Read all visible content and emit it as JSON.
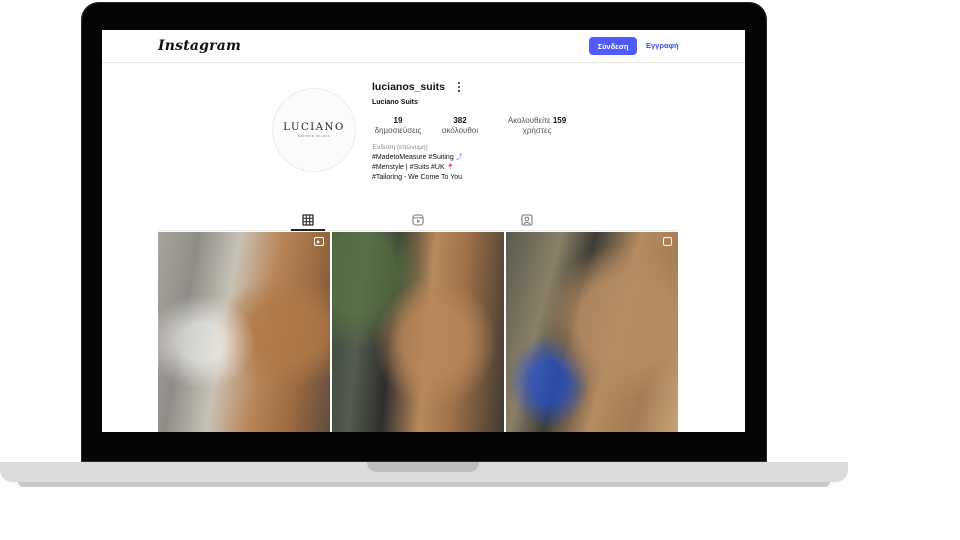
{
  "header": {
    "logo": "Instagram",
    "login_label": "Σύνδεση",
    "signup_label": "Εγγραφή"
  },
  "profile": {
    "avatar_text": "LUCIANO",
    "avatar_subtext": "BESPOKE TAILORS",
    "username": "lucianos_suits",
    "full_name": "Luciano Suits",
    "stats": {
      "posts_count": "19",
      "posts_label": "δημοσιεύσεις",
      "followers_count": "382",
      "followers_label": "ακόλουθοι",
      "following_prefix": "Ακολουθείτε",
      "following_count": "159",
      "following_label": "χρήστες"
    },
    "category": "Ένδυση (επώνυμη)",
    "bio_lines": [
      "#MadetoMeasure #Suiting",
      "#Menstyle | #Suits #UK",
      "#Tailoring - We Come To You"
    ]
  },
  "tabs": [
    {
      "icon": "grid-icon",
      "active": true
    },
    {
      "icon": "reels-icon",
      "active": false
    },
    {
      "icon": "tagged-icon",
      "active": false
    }
  ],
  "icons": {
    "more": "more-options-icon",
    "reel_badge": "reel-badge-icon"
  },
  "colors": {
    "accent": "#4f5bff",
    "link": "#3a4cf0",
    "frame": "#050505"
  }
}
